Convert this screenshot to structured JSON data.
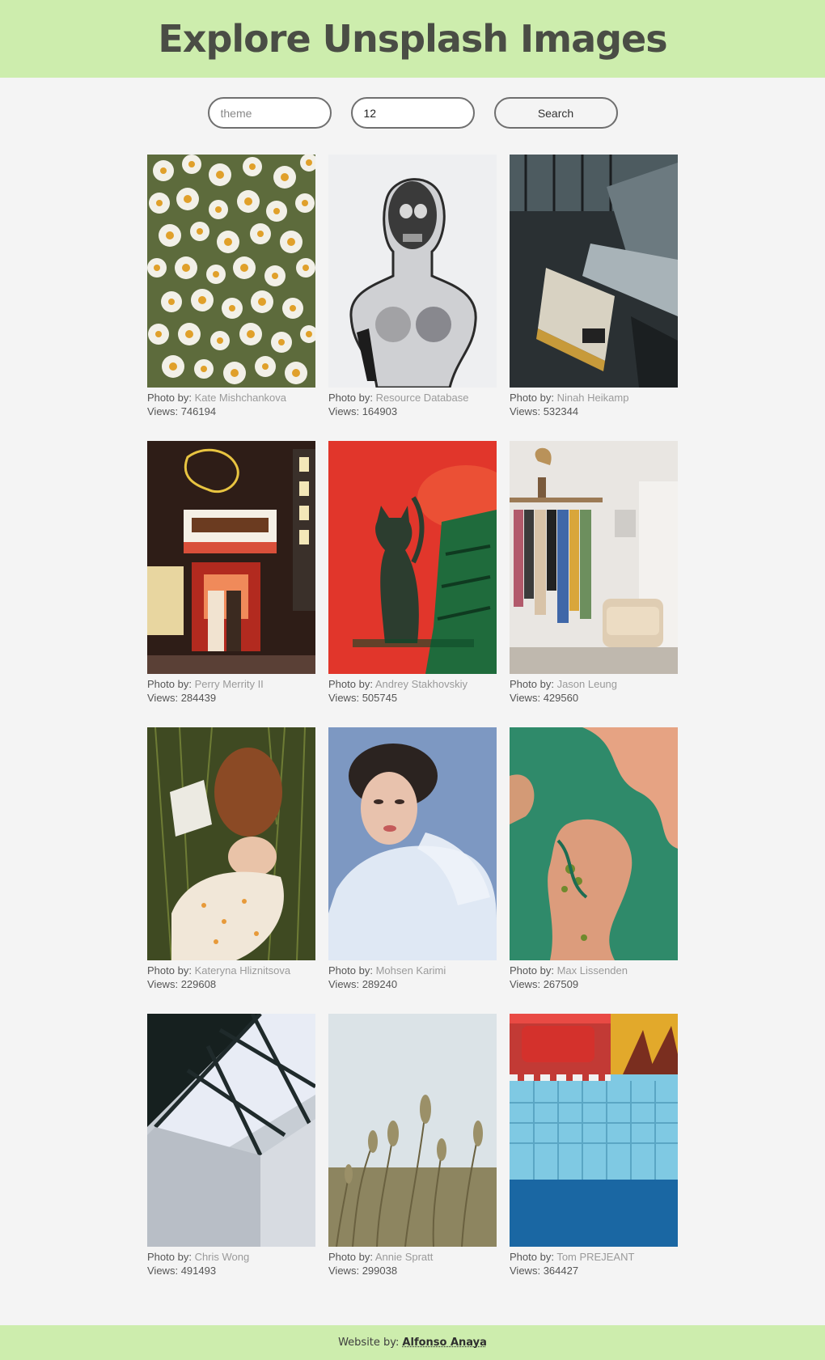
{
  "header": {
    "title": "Explore Unsplash Images"
  },
  "search": {
    "theme_value": "",
    "theme_placeholder": "theme",
    "count_value": "12",
    "button_label": "Search"
  },
  "labels": {
    "photo_by": "Photo by:",
    "views": "Views:"
  },
  "photos": [
    {
      "photographer": "Kate Mishchankova",
      "views": "746194",
      "subject": "white daisies"
    },
    {
      "photographer": "Resource Database",
      "views": "164903",
      "subject": "x-ray skull bust"
    },
    {
      "photographer": "Ninah Heikamp",
      "views": "532344",
      "subject": "bus under building"
    },
    {
      "photographer": "Perry Merrity II",
      "views": "284439",
      "subject": "shinjuku street shop"
    },
    {
      "photographer": "Andrey Stakhovskiy",
      "views": "505745",
      "subject": "cat on red background"
    },
    {
      "photographer": "Jason Leung",
      "views": "429560",
      "subject": "clothes rack and armchair"
    },
    {
      "photographer": "Kateryna Hliznitsova",
      "views": "229608",
      "subject": "woman lying in grass"
    },
    {
      "photographer": "Mohsen Karimi",
      "views": "289240",
      "subject": "woman portrait in white"
    },
    {
      "photographer": "Max Lissenden",
      "views": "267509",
      "subject": "aerial river delta"
    },
    {
      "photographer": "Chris Wong",
      "views": "491493",
      "subject": "skylight architecture"
    },
    {
      "photographer": "Annie Spratt",
      "views": "299038",
      "subject": "grass field"
    },
    {
      "photographer": "Tom PREJEANT",
      "views": "364427",
      "subject": "pool tiles and red cushion"
    }
  ],
  "footer": {
    "prefix": "Website by:",
    "author": "Alfonso Anaya"
  },
  "colors": {
    "header_bg": "#cdedad",
    "page_bg": "#f4f4f4",
    "title_text": "#4a4d45"
  }
}
